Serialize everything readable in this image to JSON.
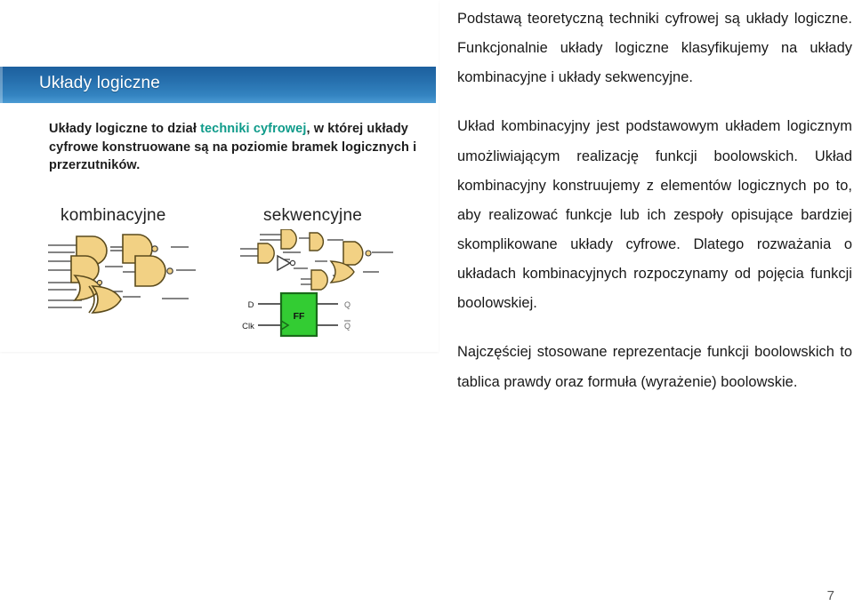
{
  "figure": {
    "banner_title": "Układy logiczne",
    "banner_color": "#2268a8",
    "body_before_accent": "Układy logiczne to dział ",
    "body_accent": "techniki cyfrowej",
    "body_after_accent": ", w której układy cyfrowe konstruowane są na poziomie bramek logicznych i przerzutników.",
    "accent_color": "#0f9b8a",
    "column_label_left": "kombinacyjne",
    "column_label_right": "sekwencyjne",
    "gate_fill": "#f2d184",
    "gate_stroke": "#5a4a1c",
    "flipflop": {
      "label": "FF",
      "fill": "#33cc33",
      "stroke": "#1a6b1a",
      "input_d": "D",
      "input_clk": "Clk",
      "output_q": "Q",
      "output_qbar": "Q"
    }
  },
  "body": {
    "paragraphs": [
      "Podstawą teoretyczną techniki cyfrowej są układy logiczne. Funkcjonalnie układy logiczne klasyfikujemy na układy kombinacyjne i układy sekwencyjne.",
      "Układ kombinacyjny jest podstawowym układem logicznym umożliwiającym realizację funkcji boolowskich. Układ kombinacyjny konstruujemy z elementów logicznych po to, aby realizować funkcje lub ich zespoły opisujące bardziej skomplikowane układy cyfrowe. Dlatego rozważania o układach kombinacyjnych rozpoczynamy od pojęcia funkcji boolowskiej.",
      "Najczęściej stosowane reprezentacje funkcji boolowskich to tablica prawdy oraz formuła (wyrażenie) boolowskie."
    ]
  },
  "footer": {
    "page_number": "7"
  }
}
